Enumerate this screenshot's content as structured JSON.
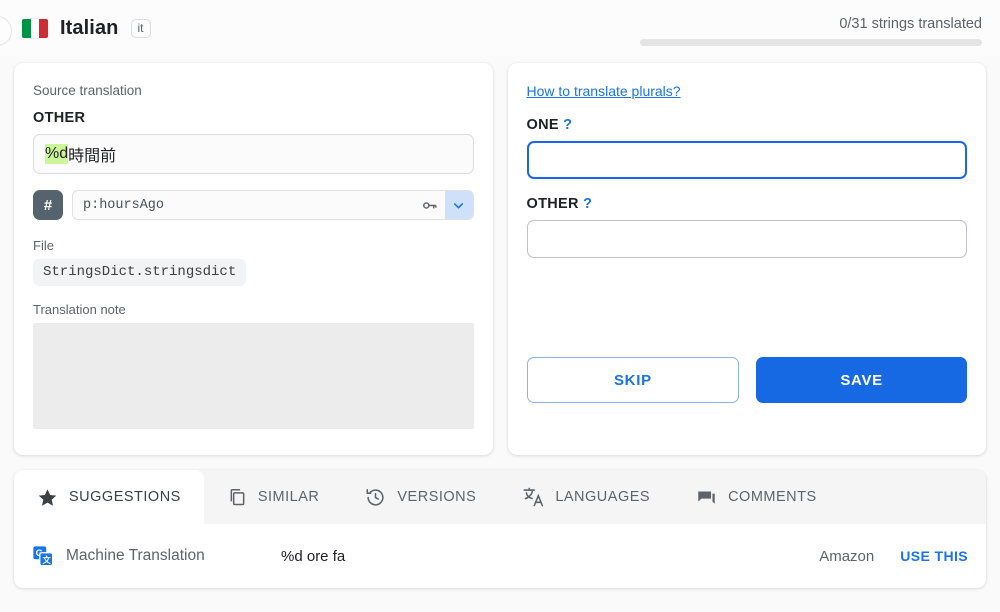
{
  "header": {
    "language_name": "Italian",
    "language_code": "it",
    "flag_icon": "italy-flag",
    "progress_text": "0/31 strings translated",
    "progress_percent": 0
  },
  "source_panel": {
    "section_label": "Source translation",
    "plural_form_label": "OTHER",
    "source_text_prefix": "%d",
    "source_text_rest": "時間前",
    "key_badge": "#",
    "key_value": "p:hoursAgo",
    "key_icon": "key-icon",
    "chevron_icon": "chevron-down-icon",
    "file_label": "File",
    "file_value": "StringsDict.stringsdict",
    "note_label": "Translation note",
    "note_value": ""
  },
  "translation_panel": {
    "help_link": "How to translate plurals?",
    "forms": [
      {
        "label": "ONE",
        "help_marker": "?",
        "value": "",
        "placeholder": "",
        "focused": true
      },
      {
        "label": "OTHER",
        "help_marker": "?",
        "value": "",
        "placeholder": "",
        "focused": false
      }
    ],
    "skip_label": "SKIP",
    "save_label": "SAVE",
    "accent_color": "#1a73e8",
    "save_color": "#1668e3"
  },
  "bottom_panel": {
    "tabs": [
      {
        "label": "SUGGESTIONS",
        "icon": "star-icon",
        "active": true
      },
      {
        "label": "SIMILAR",
        "icon": "copy-icon",
        "active": false
      },
      {
        "label": "VERSIONS",
        "icon": "history-icon",
        "active": false
      },
      {
        "label": "LANGUAGES",
        "icon": "translate-icon",
        "active": false
      },
      {
        "label": "COMMENTS",
        "icon": "comment-icon",
        "active": false
      }
    ],
    "rows": [
      {
        "icon": "google-translate-icon",
        "name": "Machine Translation",
        "value": "%d ore fa",
        "provider": "Amazon",
        "action_label": "USE THIS"
      }
    ]
  }
}
